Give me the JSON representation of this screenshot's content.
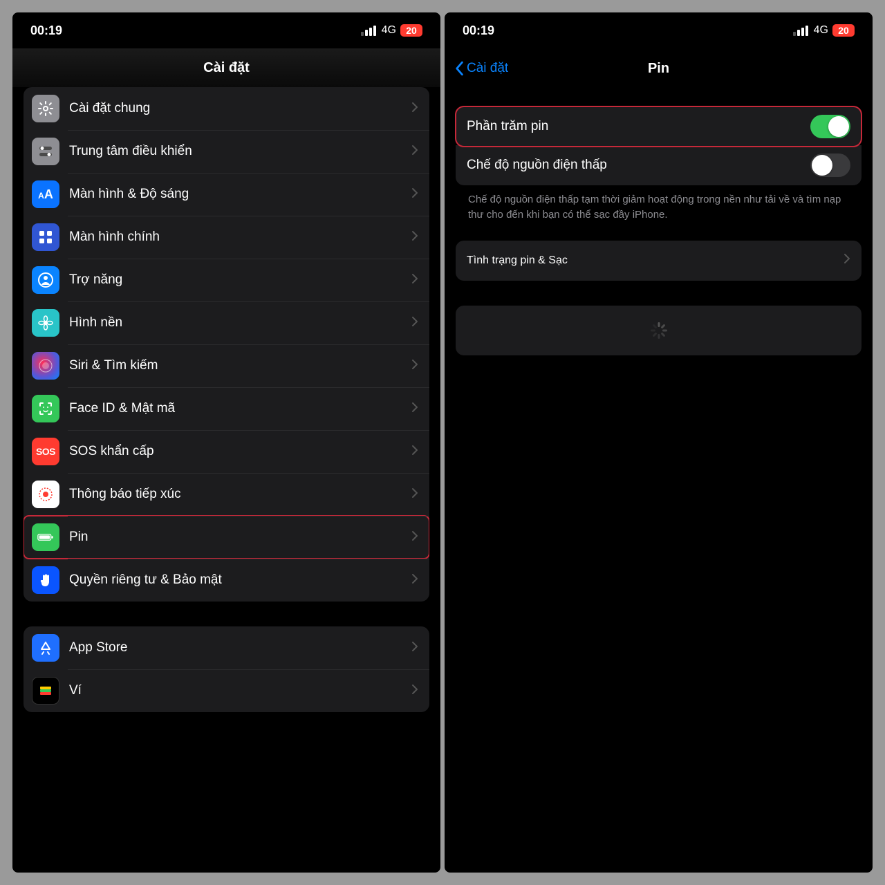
{
  "status": {
    "time": "00:19",
    "network": "4G",
    "battery": "20"
  },
  "left": {
    "title": "Cài đặt",
    "groups": [
      {
        "rows": [
          {
            "key": "general",
            "label": "Cài đặt chung",
            "iconBg": "bg-gray",
            "icon": "gear"
          },
          {
            "key": "control",
            "label": "Trung tâm điều khiển",
            "iconBg": "bg-gray2",
            "icon": "switches"
          },
          {
            "key": "display",
            "label": "Màn hình & Độ sáng",
            "iconBg": "bg-blue",
            "icon": "aa"
          },
          {
            "key": "home",
            "label": "Màn hình chính",
            "iconBg": "bg-bluehome",
            "icon": "grid"
          },
          {
            "key": "access",
            "label": "Trợ năng",
            "iconBg": "bg-access",
            "icon": "person"
          },
          {
            "key": "wallpaper",
            "label": "Hình nền",
            "iconBg": "bg-teal",
            "icon": "flower"
          },
          {
            "key": "siri",
            "label": "Siri & Tìm kiếm",
            "iconBg": "bg-siri",
            "icon": "siri"
          },
          {
            "key": "faceid",
            "label": "Face ID & Mật mã",
            "iconBg": "bg-green",
            "icon": "face"
          },
          {
            "key": "sos",
            "label": "SOS khẩn cấp",
            "iconBg": "bg-red",
            "icon": "sos"
          },
          {
            "key": "exposure",
            "label": "Thông báo tiếp xúc",
            "iconBg": "bg-white",
            "icon": "exposure"
          },
          {
            "key": "battery",
            "label": "Pin",
            "iconBg": "bg-green",
            "icon": "battery",
            "highlight": true
          },
          {
            "key": "privacy",
            "label": "Quyền riêng tư & Bảo mật",
            "iconBg": "bg-bluepriv",
            "icon": "hand"
          }
        ]
      },
      {
        "rows": [
          {
            "key": "appstore",
            "label": "App Store",
            "iconBg": "bg-appstore",
            "icon": "appstore"
          },
          {
            "key": "wallet",
            "label": "Ví",
            "iconBg": "bg-wallet",
            "icon": "wallet"
          }
        ]
      }
    ]
  },
  "right": {
    "back": "Cài đặt",
    "title": "Pin",
    "toggles": {
      "percent": {
        "label": "Phần trăm pin",
        "on": true,
        "highlight": true
      },
      "lowpower": {
        "label": "Chế độ nguồn điện thấp",
        "on": false
      }
    },
    "footer": "Chế độ nguồn điện thấp tạm thời giảm hoạt động trong nền như tải về và tìm nạp thư cho đến khi bạn có thể sạc đầy iPhone.",
    "healthRow": "Tình trạng pin & Sạc"
  }
}
